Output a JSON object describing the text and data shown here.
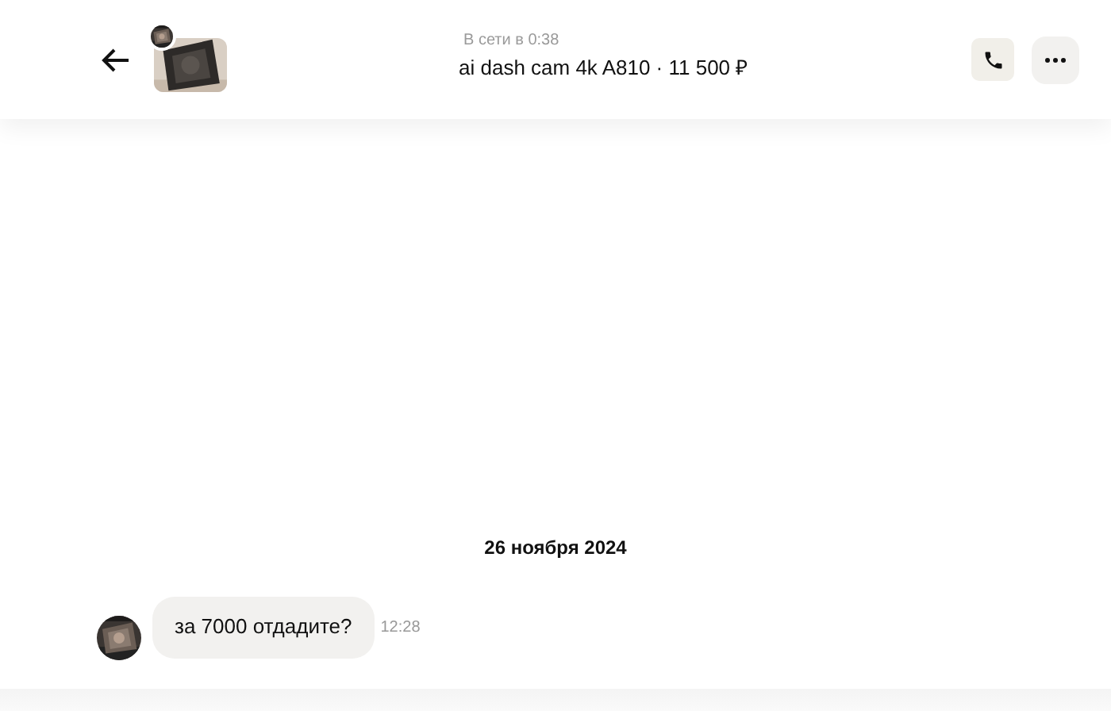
{
  "header": {
    "status": "В сети в 0:38",
    "listing": "ai dash cam 4k A810 · 11 500 ₽"
  },
  "date_separator": "26 ноября 2024",
  "messages": [
    {
      "text": "за 7000 отдадите?",
      "time": "12:28"
    }
  ]
}
